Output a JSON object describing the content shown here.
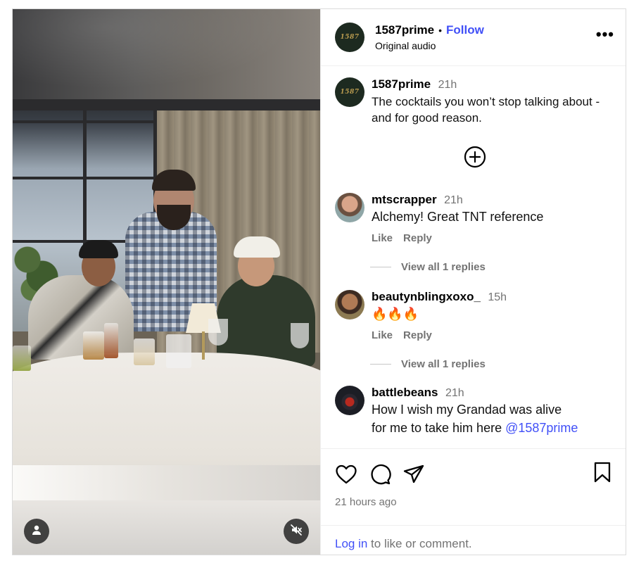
{
  "header": {
    "username": "1587prime",
    "separator": "•",
    "follow_label": "Follow",
    "audio_label": "Original audio",
    "more_label": "•••",
    "brand_mark": "1587"
  },
  "caption": {
    "username": "1587prime",
    "time": "21h",
    "text": "The cocktails you won’t stop talking about - and for good reason."
  },
  "comments": [
    {
      "username": "mtscrapper",
      "time": "21h",
      "text": "Alchemy! Great TNT reference",
      "like_label": "Like",
      "reply_label": "Reply",
      "view_replies_label": "View all 1 replies"
    },
    {
      "username": "beautynblingxoxo_",
      "time": "15h",
      "text": "🔥🔥🔥",
      "like_label": "Like",
      "reply_label": "Reply",
      "view_replies_label": "View all 1 replies"
    },
    {
      "username": "battlebeans",
      "time": "21h",
      "text": "How I wish my Grandad was alive",
      "text_cont": "for me to take him here ",
      "mention": "@1587prime"
    }
  ],
  "footer": {
    "time_ago": "21 hours ago",
    "login_link": "Log in",
    "login_rest": " to like or comment."
  },
  "icons": {
    "like": "heart-icon",
    "comment": "speech-bubble-icon",
    "share": "paper-plane-icon",
    "save": "bookmark-icon",
    "add": "plus-circle-icon",
    "user": "user-icon",
    "mute": "muted-speaker-icon"
  },
  "colors": {
    "link": "#4150f7",
    "muted_text": "#737373",
    "brand_avatar_bg": "#1d2a20",
    "brand_mark": "#b99b4f"
  }
}
